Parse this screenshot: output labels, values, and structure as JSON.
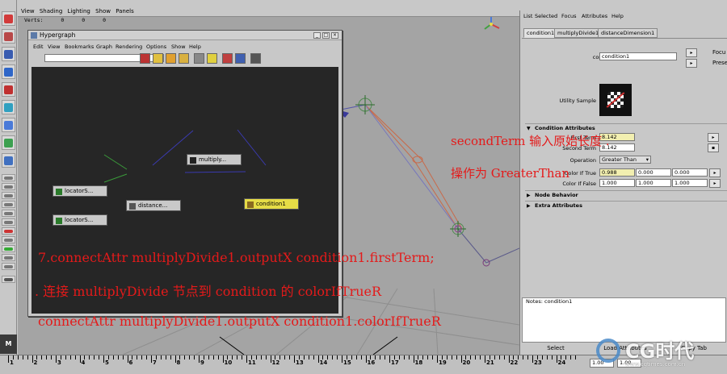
{
  "viewport": {
    "menu": [
      "View",
      "Shading",
      "Lighting",
      "Show",
      "Panels"
    ],
    "verts_label": "Verts:",
    "verts_values": [
      "0",
      "0",
      "0"
    ]
  },
  "hypergraph": {
    "title": "Hypergraph",
    "menu": [
      "Edit",
      "View",
      "Bookmarks",
      "Graph",
      "Rendering",
      "Options",
      "Show",
      "Help"
    ],
    "window_buttons": [
      "_",
      "□",
      "×"
    ],
    "nodes": {
      "multiply": "multiply...",
      "locator1": "locatorS...",
      "locator2": "locatorS...",
      "distance": "distance...",
      "condition": "condition1"
    }
  },
  "attribute_editor": {
    "menu": [
      "List",
      "Selected",
      "Focus",
      "Attributes",
      "Help"
    ],
    "tabs": [
      "condition1",
      "multiplyDivide1",
      "distanceDimension1"
    ],
    "node_type_label": "condition:",
    "node_name": "condition1",
    "focus_button": "Focu",
    "presets_button": "Prese",
    "utility_sample_label": "Utility Sample",
    "sections": {
      "condition": "Condition Attributes",
      "node_behavior": "Node Behavior",
      "extra": "Extra Attributes"
    },
    "first_term_label": "First Term",
    "first_term_value": "8.142",
    "second_term_label": "Second Term",
    "second_term_value": "8.142",
    "operation_label": "Operation",
    "operation_value": "Greater Than",
    "color_if_true_label": "Color If True",
    "color_if_true": [
      "0.988",
      "0.000",
      "0.000"
    ],
    "color_if_false_label": "Color If False",
    "color_if_false": [
      "1.000",
      "1.000",
      "1.000"
    ],
    "notes_label": "Notes: condition1",
    "bottom_buttons": [
      "Select",
      "Load Attributes",
      "Copy Tab"
    ]
  },
  "timeline": {
    "ticks": [
      "1",
      "2",
      "3",
      "4",
      "5",
      "6",
      "7",
      "8",
      "9",
      "10",
      "11",
      "12",
      "13",
      "14",
      "15",
      "16",
      "17",
      "18",
      "19",
      "20",
      "21",
      "22",
      "23",
      "24"
    ],
    "start_value": "1.00",
    "end_value": "1.00"
  },
  "annotations": {
    "second_term_note": "secondTerm 输入原始长度 .",
    "operation_note": "操作为 GreaterThan",
    "step7": "7.connectAttr multiplyDivide1.outputX condition1.firstTerm;",
    "connect_note": ". 连接 multiplyDivide 节点到 condition 的 colorIfTrueR",
    "command": "connectAttr multiplyDivide1.outputX condition1.colorIfTrueR"
  },
  "watermark": {
    "brand": "CG时代",
    "url": "www.cgtimes.com.cn"
  },
  "colors": {
    "annotation_red": "#e41a1a",
    "selected_node": "#e6dc46",
    "hypergraph_bg": "#262626",
    "viewport_bg": "#a4a4a4"
  }
}
